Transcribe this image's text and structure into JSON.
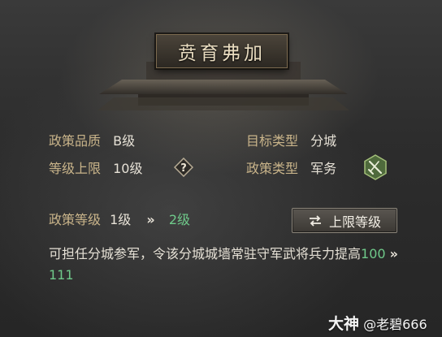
{
  "title": "贲育弗加",
  "policy": {
    "quality_label": "政策品质",
    "quality_value": "B级",
    "target_type_label": "目标类型",
    "target_type_value": "分城",
    "level_cap_label": "等级上限",
    "level_cap_value": "10级",
    "policy_type_label": "政策类型",
    "policy_type_value": "军务",
    "level_label": "政策等级",
    "level_current": "1级",
    "level_arrow": "»",
    "level_next": "2级",
    "help_icon": "question-icon",
    "type_icon": "military-sword-icon"
  },
  "upgrade_cap_button": {
    "label": "上限等级",
    "icon": "swap-arrows-icon"
  },
  "description": {
    "text": "可担任分城参军，令该分城城墙常驻守军武将兵力提高",
    "from": "100",
    "arrow": "»",
    "to": "111"
  },
  "watermark": {
    "brand": "大神",
    "user": "@老碧666"
  },
  "colors": {
    "label": "#c9b48a",
    "value": "#e6e1d6",
    "upgrade_green": "#6fc98a"
  }
}
